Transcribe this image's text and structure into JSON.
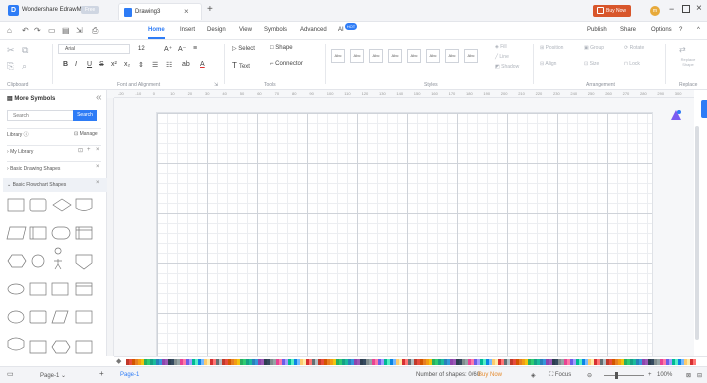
{
  "window": {
    "app_name": "Wondershare EdrawMax",
    "free_badge": "Free",
    "document_tab": "Drawing3",
    "close_tab": "×",
    "new_tab": "+",
    "buy_now": "Buy Now",
    "avatar_initials": "m"
  },
  "menubar": {
    "items": [
      "Home",
      "Insert",
      "Design",
      "View",
      "Symbols",
      "Advanced",
      "AI"
    ],
    "active": "Home",
    "right": [
      "Publish",
      "Share",
      "Options"
    ]
  },
  "ribbon": {
    "clipboard_caption": "Clipboard",
    "font_caption": "Font and Alignment",
    "font_name": "Arial",
    "font_size": "12",
    "bold": "B",
    "italic": "I",
    "underline": "U",
    "strike": "S",
    "font_color": "A",
    "tools_caption": "Tools",
    "select": "Select",
    "shape": "Shape",
    "text": "Text",
    "connector": "Connector",
    "style_swatch": "Abc",
    "styles_caption": "Styles",
    "fill": "Fill",
    "line": "Line",
    "shadow": "Shadow",
    "position": "Position",
    "group": "Group",
    "rotate": "Rotate",
    "align": "Align",
    "size": "Size",
    "lock": "Lock",
    "arrangement_caption": "Arrangement",
    "replace_shape": "Replace Shape",
    "replace_caption": "Replace"
  },
  "left_panel": {
    "title": "More Symbols",
    "search_placeholder": "Search",
    "search_button": "Search",
    "library": "Library",
    "manage": "Manage",
    "my_library": "My Library",
    "basic_drawing": "Basic Drawing Shapes",
    "basic_flowchart": "Basic Flowchart Shapes"
  },
  "ruler": {
    "ticks": [
      "-20",
      "-10",
      "0",
      "10",
      "20",
      "30",
      "40",
      "50",
      "60",
      "70",
      "80",
      "90",
      "100",
      "110",
      "120",
      "130",
      "140",
      "150",
      "160",
      "170",
      "180",
      "190",
      "200",
      "210",
      "220",
      "230",
      "240",
      "250",
      "260",
      "270",
      "280",
      "290",
      "300"
    ]
  },
  "palette": {
    "colors": [
      "#c0392b",
      "#e74c3c",
      "#d35400",
      "#e67e22",
      "#f39c12",
      "#f1c40f",
      "#27ae60",
      "#2ecc71",
      "#16a085",
      "#1abc9c",
      "#2980b9",
      "#3498db",
      "#8e44ad",
      "#9b59b6",
      "#2c3e50",
      "#34495e",
      "#7f8c8d",
      "#95a5a6",
      "#e84393",
      "#fd79a8",
      "#6c5ce7",
      "#a29bfe",
      "#00b894",
      "#55efc4",
      "#0984e3",
      "#74b9ff",
      "#fdcb6e",
      "#ffeaa7",
      "#d63031",
      "#ff7675",
      "#636e72",
      "#b2bec3"
    ]
  },
  "status": {
    "page_label": "Page-1",
    "page_tab": "Page-1",
    "add_page": "+",
    "shapes_count": "Number of shapes: 0/60",
    "buy_now": "Buy Now",
    "focus": "Focus",
    "zoom": "100%"
  }
}
